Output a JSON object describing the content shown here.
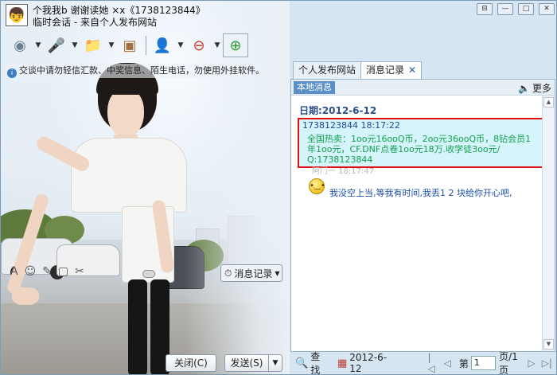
{
  "header": {
    "title_line1": "个我我b 谢谢读她 ×x《1738123844》",
    "title_line2": "临时会话 - 来自个人发布网站"
  },
  "toolbar": {
    "items": [
      {
        "icon": "video-camera-icon",
        "glyph": "◉"
      },
      {
        "icon": "microphone-icon",
        "glyph": "🎤"
      },
      {
        "icon": "file-transfer-icon",
        "glyph": "📁"
      },
      {
        "icon": "app-window-icon",
        "glyph": "▣"
      },
      {
        "icon": "customer-service-icon",
        "glyph": "👤"
      },
      {
        "icon": "block-user-icon",
        "glyph": "⊖"
      },
      {
        "icon": "add-friend-icon",
        "glyph": "⊕"
      }
    ]
  },
  "notice": "交谈中请勿轻信汇款、中奖信息、陌生电话，勿使用外挂软件。",
  "buttons": {
    "message_record": "消息记录",
    "close": "关闭(C)",
    "send": "发送(S)"
  },
  "tabs": [
    {
      "label": "个人发布网站",
      "active": false
    },
    {
      "label": "消息记录",
      "active": true,
      "closable": true
    }
  ],
  "history": {
    "local_tag": "本地消息",
    "more_label": "更多",
    "date_label": "日期:2012-6-12",
    "message1_header": "1738123844  18:17:22",
    "message1_body": "全国热卖：1oo元16ooQ币，2oo元36ooQ币，8钻会员1年1oo元，CF.DNF点卷1oo元18万.收学徒3oo元/ Q:1738123844",
    "message2_ghost": "阿门一  18:17:47",
    "message2_body": "我没空上当,等我有时间,我丢1 2 块给你开心吧,"
  },
  "bottombar": {
    "search_label": "查找",
    "date": "2012-6-12",
    "page_prefix": "第",
    "page_value": "1",
    "page_suffix": "页/1页"
  },
  "colors": {
    "highlight_border": "#e01010",
    "message_bg": "#d6f4fb",
    "ad_text": "#12a04a",
    "reply_text": "#1d4fa8"
  }
}
